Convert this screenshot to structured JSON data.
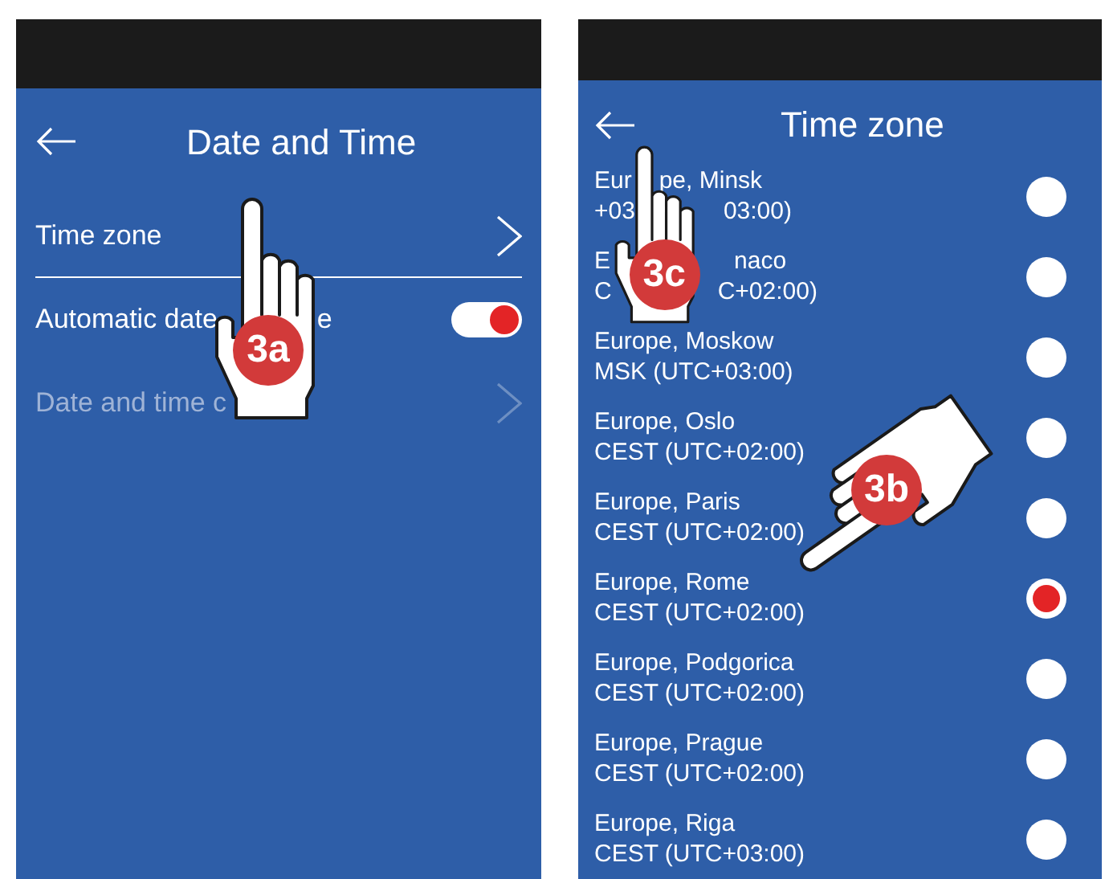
{
  "screens": [
    {
      "title": "Date and Time",
      "step": "3a",
      "items": [
        {
          "kind": "link",
          "parts": [
            "Time zone"
          ],
          "disabled": false,
          "underlined": true
        },
        {
          "kind": "toggle",
          "parts": [
            "Automatic date",
            "e"
          ],
          "on": true
        },
        {
          "kind": "link",
          "parts": [
            "Date and time c"
          ],
          "disabled": true,
          "underlined": false
        }
      ]
    },
    {
      "title": "Time zone",
      "step": "3c",
      "step2": "3b",
      "zones": [
        {
          "parts": [
            "Eur",
            "pe, Minsk"
          ],
          "parts2": [
            "+03",
            "03:00)"
          ],
          "selected": false
        },
        {
          "parts": [
            "E",
            "naco"
          ],
          "parts2": [
            "C",
            "C+02:00)"
          ],
          "selected": false
        },
        {
          "parts": [
            "Europe, Moskow"
          ],
          "parts2": [
            "MSK (UTC+03:00)"
          ],
          "selected": false
        },
        {
          "parts": [
            "Europe, Oslo"
          ],
          "parts2": [
            "CEST (UTC+02:00)"
          ],
          "selected": false
        },
        {
          "parts": [
            "Europe, Paris"
          ],
          "parts2": [
            "CEST (UTC+02:00)"
          ],
          "selected": false
        },
        {
          "parts": [
            "Europe, Rome"
          ],
          "parts2": [
            "CEST (UTC+02:00)"
          ],
          "selected": true
        },
        {
          "parts": [
            "Europe, Podgorica"
          ],
          "parts2": [
            "CEST (UTC+02:00)"
          ],
          "selected": false
        },
        {
          "parts": [
            "Europe, Prague"
          ],
          "parts2": [
            "CEST (UTC+02:00)"
          ],
          "selected": false
        },
        {
          "parts": [
            "Europe, Riga"
          ],
          "parts2": [
            "CEST (UTC+03:00)"
          ],
          "selected": false
        }
      ]
    }
  ]
}
